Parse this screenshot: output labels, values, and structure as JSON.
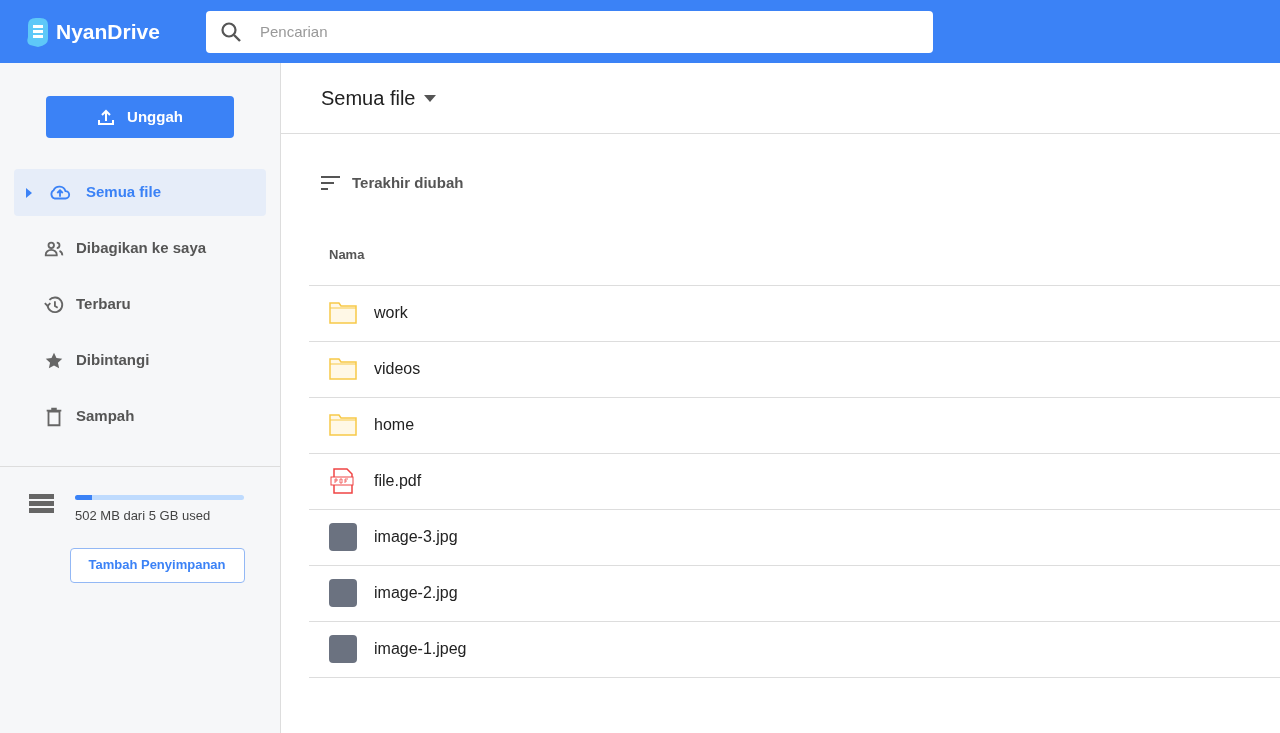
{
  "header": {
    "logo": "NyanDrive",
    "search": {
      "placeholder": "Pencarian"
    }
  },
  "sidebar": {
    "upload_button": "Unggah",
    "items": [
      {
        "kind": "cloud",
        "label": "Semua file",
        "selected": true
      },
      {
        "kind": "people",
        "label": "Dibagikan ke saya",
        "selected": false
      },
      {
        "kind": "history",
        "label": "Terbaru",
        "selected": false
      },
      {
        "kind": "star",
        "label": "Dibintangi",
        "selected": false
      },
      {
        "kind": "trash",
        "label": "Sampah",
        "selected": false
      }
    ],
    "storage": {
      "level": 0.1,
      "text": "502 MB dari 5 GB used",
      "button": "Tambah Penyimpanan"
    }
  },
  "main": {
    "title": "Semua file",
    "sort": "Terakhir diubah",
    "table": {
      "columns": [
        "Nama"
      ],
      "rows": [
        {
          "kind": "folder",
          "name": "work"
        },
        {
          "kind": "folder",
          "name": "videos"
        },
        {
          "kind": "folder",
          "name": "home"
        },
        {
          "kind": "pdf",
          "name": "file.pdf"
        },
        {
          "kind": "image",
          "name": "image-3.jpg"
        },
        {
          "kind": "image",
          "name": "image-2.jpg"
        },
        {
          "kind": "image",
          "name": "image-1.jpeg"
        }
      ]
    }
  }
}
